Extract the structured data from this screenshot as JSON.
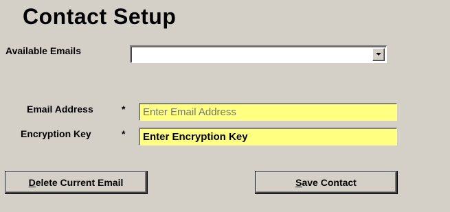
{
  "title": "Contact Setup",
  "available_emails": {
    "label": "Available Emails",
    "selected_value": ""
  },
  "email_address": {
    "label": "Email Address",
    "required_marker": "*",
    "placeholder": "Enter Email Address",
    "value": ""
  },
  "encryption_key": {
    "label": "Encryption Key",
    "required_marker": "*",
    "value": "Enter Encryption Key"
  },
  "buttons": {
    "delete": {
      "mnemonic": "D",
      "rest": "elete Current Email"
    },
    "save": {
      "mnemonic": "S",
      "rest": "ave Contact"
    }
  },
  "colors": {
    "window_background": "#d4d0c8",
    "field_background": "#ffff80"
  },
  "icons": [
    "chevron-down-icon"
  ]
}
